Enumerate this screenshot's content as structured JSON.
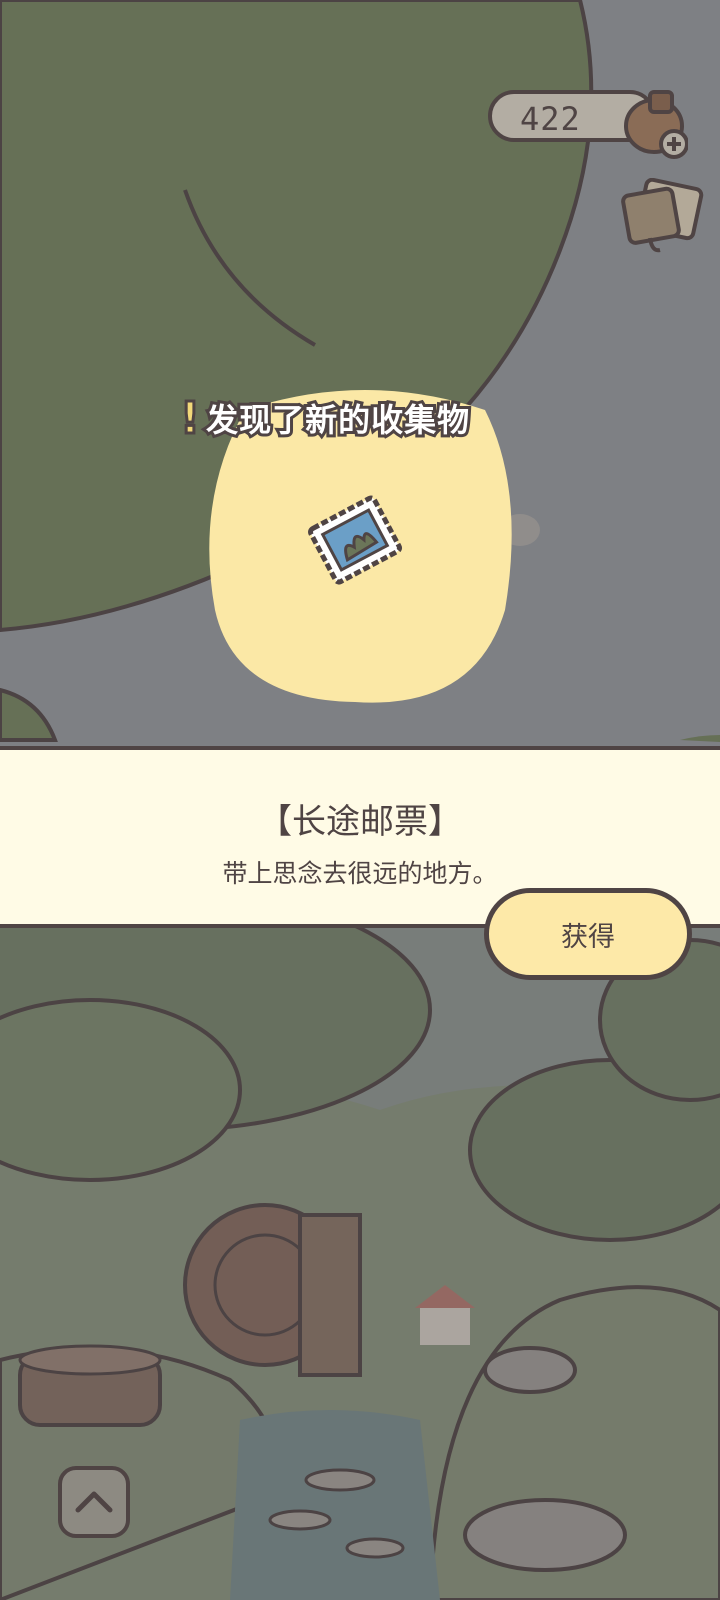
{
  "hud": {
    "clover_count": "422",
    "clover_icon": "clover-pot-plus-icon",
    "ticket_icon": "tickets-icon"
  },
  "discovery": {
    "banner_text": "发现了新的收集物",
    "item_icon": "stamp-icon"
  },
  "item": {
    "name": "【长途邮票】",
    "description": "带上思念去很远的地方。",
    "get_button_label": "获得"
  },
  "nav": {
    "up_icon": "chevron-up-icon"
  },
  "colors": {
    "outline": "#4f4444",
    "panel_bg": "#fffbe6",
    "button_bg": "#fde9a8",
    "blob_yellow": "#fbe8a6",
    "leaf_green": "#6e7b5c"
  }
}
